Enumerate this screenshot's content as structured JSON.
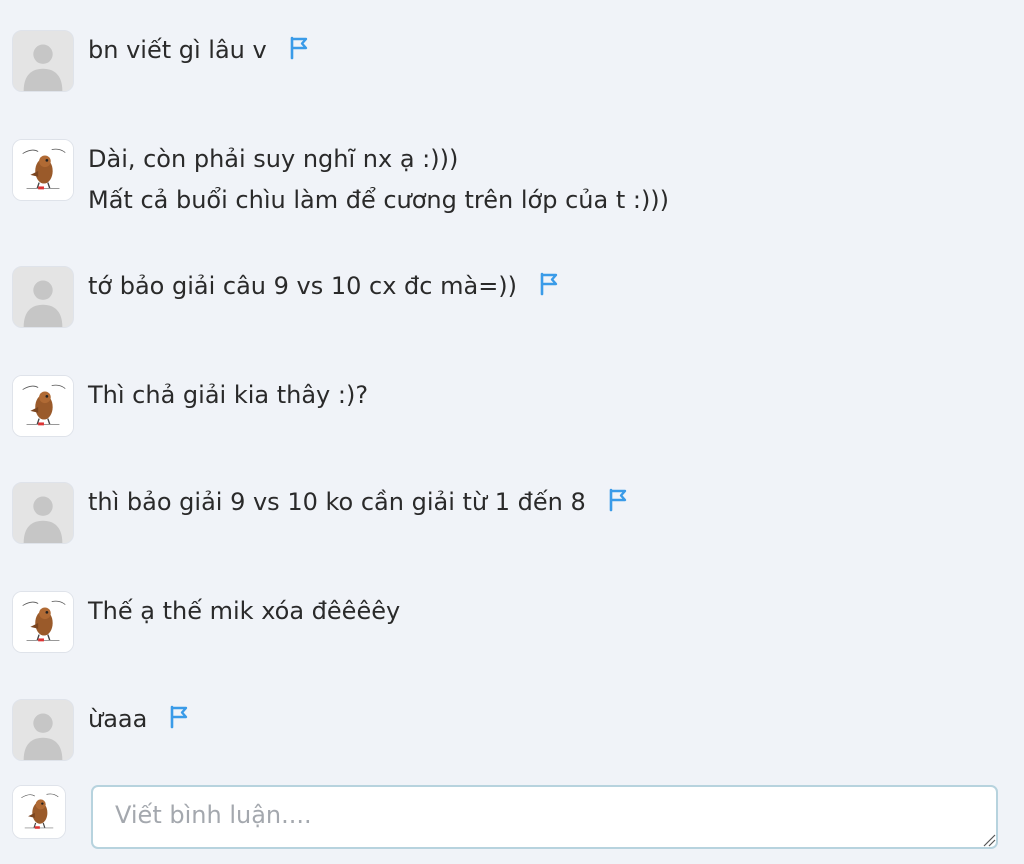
{
  "comments": [
    {
      "author_type": "anonymous",
      "lines": [
        "bn viết gì lâu v"
      ],
      "has_flag": true
    },
    {
      "author_type": "owner",
      "lines": [
        "Dài, còn phải suy nghĩ nx ạ :)))",
        "Mất cả buổi chìu làm để cương trên lớp của t :)))"
      ],
      "has_flag": false
    },
    {
      "author_type": "anonymous",
      "lines": [
        "tớ bảo giải câu 9 vs 10 cx đc mà=))"
      ],
      "has_flag": true
    },
    {
      "author_type": "owner",
      "lines": [
        "Thì chả giải kia thây :)?"
      ],
      "has_flag": false
    },
    {
      "author_type": "anonymous",
      "lines": [
        "thì bảo giải 9 vs 10 ko cần giải từ 1 đến 8"
      ],
      "has_flag": true
    },
    {
      "author_type": "owner",
      "lines": [
        "Thế ạ thế mik xóa đêêêêy"
      ],
      "has_flag": false
    },
    {
      "author_type": "anonymous",
      "lines": [
        "ừaaa"
      ],
      "has_flag": true
    }
  ],
  "composer": {
    "placeholder": "Viết bình luận...."
  },
  "icons": {
    "flag": "flag-icon",
    "anonymous_avatar": "default-user-icon",
    "owner_avatar": "owl-sticker-avatar"
  },
  "colors": {
    "background": "#f0f3f8",
    "flag": "#3a9be8",
    "input_border": "#b7d3de",
    "placeholder": "#a4a8ae"
  }
}
